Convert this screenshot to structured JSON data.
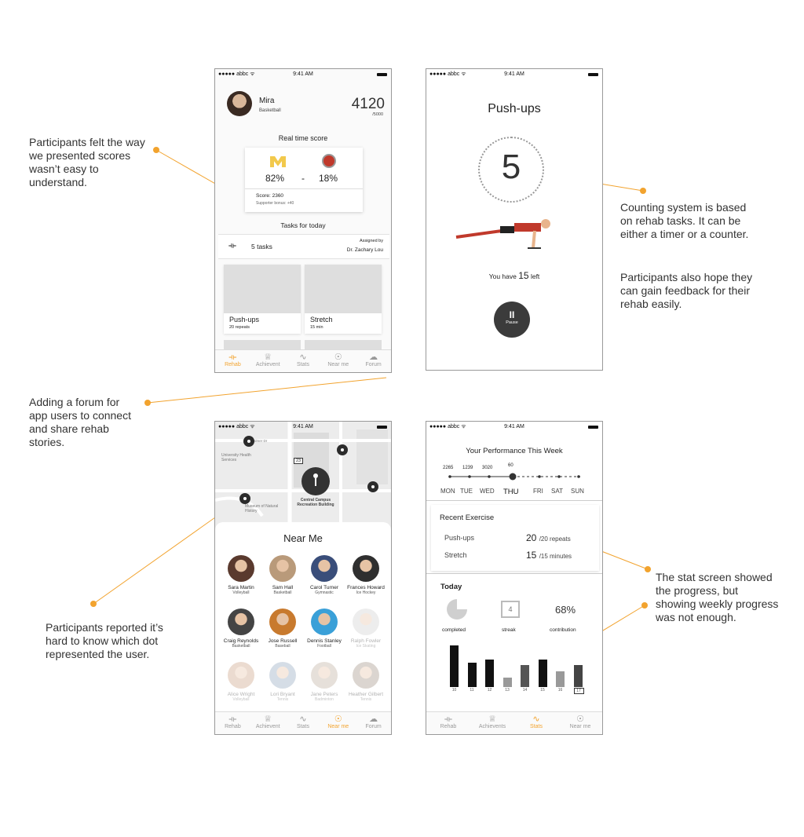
{
  "annotations": {
    "scores": "Participants felt the way we presented scores wasn’t easy to understand.",
    "counting": "Counting system is based on rehab tasks. It can be either a timer or a counter.",
    "feedback": "Participants also hope they can gain feedback for their rehab easily.",
    "forum": "Adding a forum for app users to connect and share rehab stories.",
    "map": "Participants reported it’s hard to know which dot represented the user.",
    "stat": "The stat screen showed the progress, but showing weekly progress was not enough."
  },
  "status_bar": {
    "carrier": "●●●●● abbc ᯤ",
    "time": "9:41 AM"
  },
  "home": {
    "user_name": "Mira",
    "user_sport": "Basketball",
    "points": "4120",
    "points_max": "/5000",
    "realtime_title": "Real time score",
    "team_left_pct": "82%",
    "dash": "-",
    "team_right_pct": "18%",
    "score": "Score: 2360",
    "bonus": "Supporter bonus: +40",
    "tasks_title": "Tasks for today",
    "task_count": "5 tasks",
    "assigned_by": "Assigned by",
    "doctor": "Dr. Zachary Lou",
    "tasks": [
      {
        "name": "Push-ups",
        "detail": "20 repeats"
      },
      {
        "name": "Stretch",
        "detail": "15 min"
      }
    ]
  },
  "pushups": {
    "title": "Push-ups",
    "count": "5",
    "you_have": "You have",
    "left_number": "15",
    "left_word": "left",
    "pause": "Pause"
  },
  "map": {
    "labels": {
      "street": "Palmer Dr",
      "university": "University Health Services",
      "museum": "Museum of Natural History",
      "rec": "Central Campus Recreation Building",
      "route": "23"
    }
  },
  "nearme": {
    "title": "Near Me",
    "people": [
      {
        "name": "Sara Martin",
        "sport": "Volleyball",
        "color": "#5a3a2e"
      },
      {
        "name": "Sam Hall",
        "sport": "Basketball",
        "color": "#b99a7a"
      },
      {
        "name": "Carol Turner",
        "sport": "Gymnastic",
        "color": "#3a4e7a"
      },
      {
        "name": "Frances Howard",
        "sport": "Ice Hockey",
        "color": "#2f2f2f"
      },
      {
        "name": "Craig Reynolds",
        "sport": "Basketball",
        "color": "#444444"
      },
      {
        "name": "Jose Russell",
        "sport": "Baseball",
        "color": "#c87a2e"
      },
      {
        "name": "Dennis Stanley",
        "sport": "Football",
        "color": "#3aa0d8"
      },
      {
        "name": "Ralph Fowler",
        "sport": "Ice Skating",
        "color": "#cccccc"
      },
      {
        "name": "Alice Wright",
        "sport": "Volleyball",
        "color": "#c89a7a"
      },
      {
        "name": "Lori Bryant",
        "sport": "Tennis",
        "color": "#8aa0b8"
      },
      {
        "name": "Jane Peters",
        "sport": "Badminton",
        "color": "#b8a898"
      },
      {
        "name": "Heather Gilbert",
        "sport": "Tennis",
        "color": "#9a8a7a"
      }
    ]
  },
  "stats": {
    "title": "Your Performance This Week",
    "week_values": [
      "2265",
      "1239",
      "3020",
      "60"
    ],
    "days": [
      "MON",
      "TUE",
      "WED",
      "THU",
      "FRI",
      "SAT",
      "SUN"
    ],
    "recent_title": "Recent Exercise",
    "exercises": [
      {
        "name": "Push-ups",
        "value": "20",
        "total": "/20 repeats"
      },
      {
        "name": "Stretch",
        "value": "15",
        "total": "/15 minutes"
      }
    ],
    "today_title": "Today",
    "streak_day": "4",
    "contribution_pct": "68%",
    "metric_labels": [
      "completed",
      "streak",
      "contribution"
    ],
    "bar_days": [
      "10",
      "11",
      "12",
      "13",
      "14",
      "15",
      "16",
      "17"
    ],
    "bar_values": [
      0.95,
      0.55,
      0.62,
      0.22,
      0.5,
      0.62,
      0.35,
      0.5
    ],
    "bar_colors": [
      "#111111",
      "#111111",
      "#111111",
      "#999999",
      "#555555",
      "#111111",
      "#999999",
      "#444444"
    ]
  },
  "tabs": {
    "home": [
      "Rehab",
      "Achievent",
      "Stats",
      "Near me",
      "Forum"
    ],
    "nearme": [
      "Rehab",
      "Achievent",
      "Stats",
      "Near me",
      "Forum"
    ],
    "stats": [
      "Rehab",
      "Achievents",
      "Stats",
      "Near me"
    ]
  }
}
